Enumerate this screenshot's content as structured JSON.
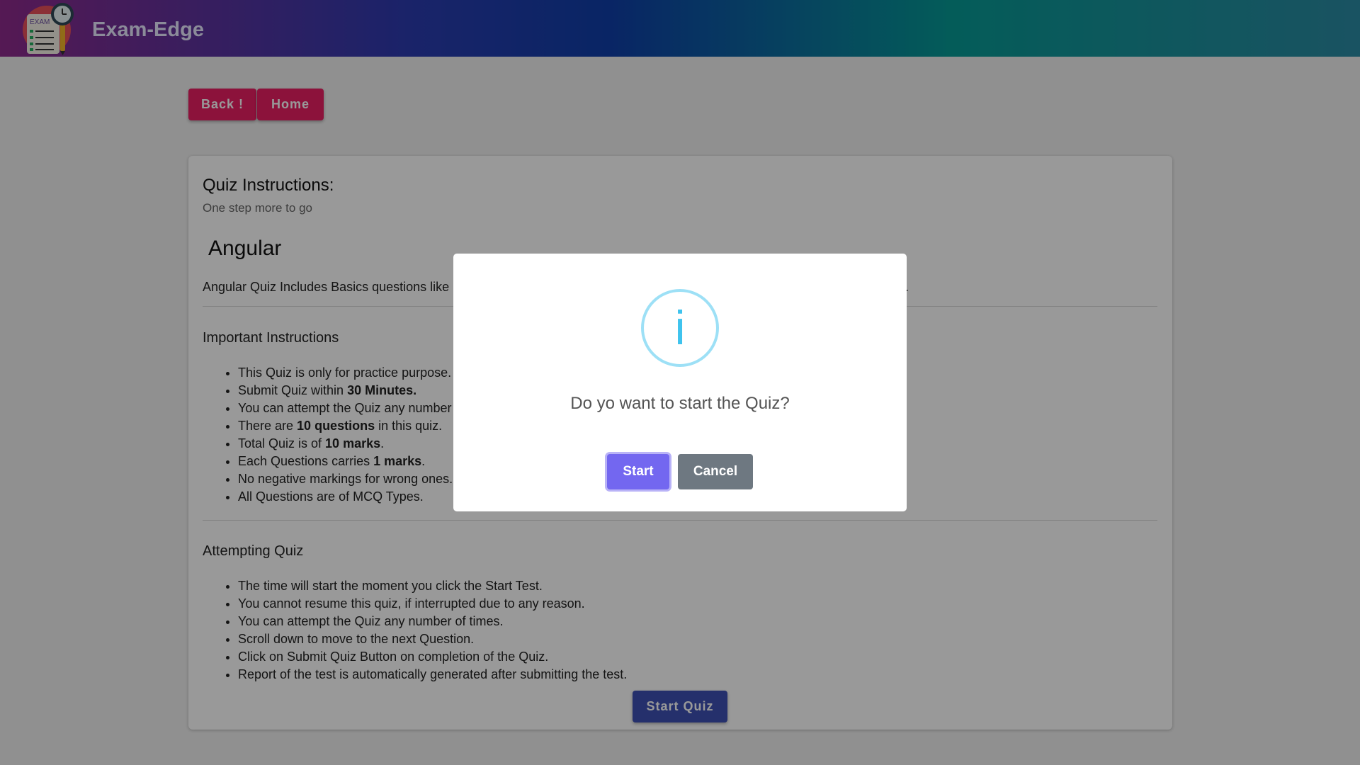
{
  "header": {
    "brand": "Exam-Edge",
    "logo_text": "EXAM"
  },
  "nav": {
    "back_label": "Back !",
    "home_label": "Home"
  },
  "card": {
    "title": "Quiz Instructions:",
    "subtitle": "One step more to go",
    "quiz_name": "Angular",
    "description": "Angular Quiz Includes Basics questions like",
    "description_tail": ".",
    "important": {
      "heading": "Important Instructions",
      "items": [
        {
          "pre": "This Quiz is only for practice purpose.",
          "bold": "",
          "post": ""
        },
        {
          "pre": "Submit Quiz within ",
          "bold": "30 Minutes.",
          "post": ""
        },
        {
          "pre": "You can attempt the Quiz any number",
          "bold": "",
          "post": ""
        },
        {
          "pre": "There are ",
          "bold": "10 questions",
          "post": " in this quiz."
        },
        {
          "pre": "Total Quiz is of ",
          "bold": "10 marks",
          "post": "."
        },
        {
          "pre": "Each Questions carries ",
          "bold": "1 marks",
          "post": "."
        },
        {
          "pre": "No negative markings for wrong ones.",
          "bold": "",
          "post": ""
        },
        {
          "pre": "All Questions are of MCQ Types.",
          "bold": "",
          "post": ""
        }
      ]
    },
    "attempting": {
      "heading": "Attempting Quiz",
      "items": [
        "The time will start the moment you click the Start Test.",
        "You cannot resume this quiz, if interrupted due to any reason.",
        "You can attempt the Quiz any number of times.",
        "Scroll down to move to the next Question.",
        "Click on Submit Quiz Button on completion of the Quiz.",
        "Report of the test is automatically generated after submitting the test."
      ]
    },
    "start_button": "Start Quiz"
  },
  "dialog": {
    "icon": "info-icon",
    "icon_glyph": "i",
    "message": "Do yo want to start the Quiz?",
    "confirm_label": "Start",
    "cancel_label": "Cancel"
  },
  "colors": {
    "accent_pink": "#e91e63",
    "primary_indigo": "#3f51b5",
    "confirm": "#7367f0",
    "cancel": "#6e7881",
    "info": "#3fc3ee"
  }
}
